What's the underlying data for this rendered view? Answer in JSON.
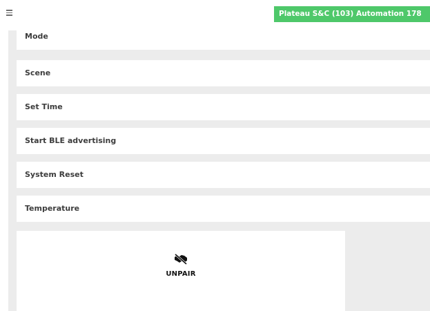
{
  "header": {
    "menu_icon": "hamburger-menu-icon",
    "device_title": "Plateau S&C (103) Automation 178",
    "device_title_bg": "#4ec86a"
  },
  "settings": {
    "items": [
      {
        "label": "Mode"
      },
      {
        "label": "Scene"
      },
      {
        "label": "Set Time"
      },
      {
        "label": "Start BLE advertising"
      },
      {
        "label": "System Reset"
      },
      {
        "label": "Temperature"
      }
    ]
  },
  "unpair": {
    "icon": "unpair-icon",
    "label": "UNPAIR"
  }
}
